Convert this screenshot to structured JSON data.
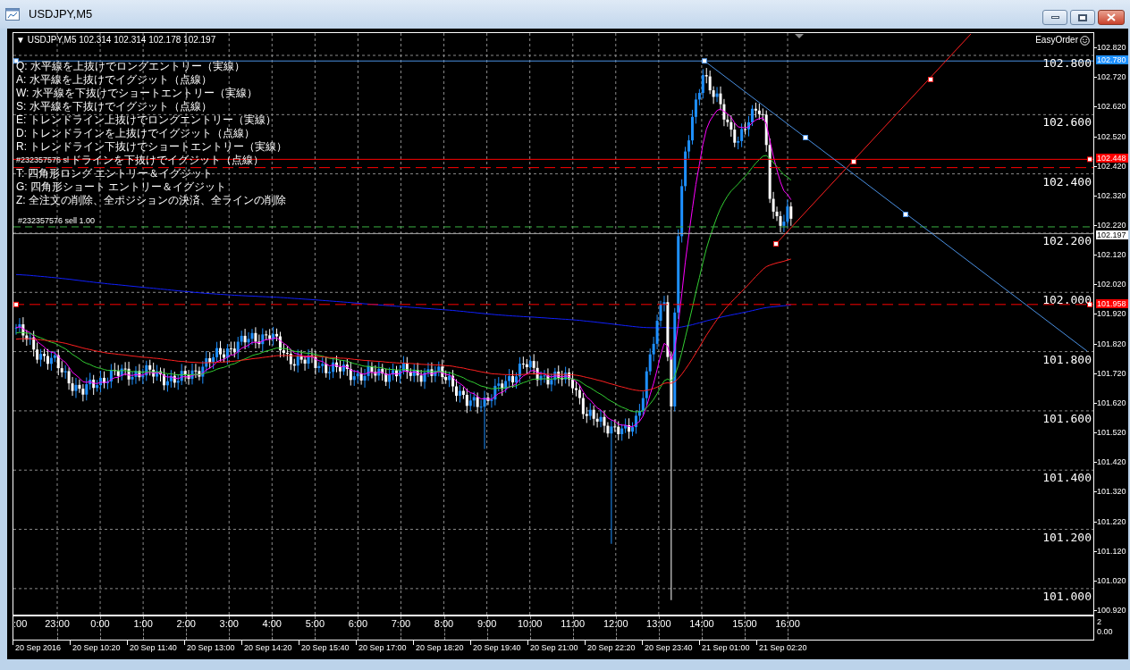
{
  "window": {
    "title": "USDJPY,M5"
  },
  "chart": {
    "header": "▼ USDJPY,M5  102.314 102.314 102.178 102.197",
    "panel_label": "EasyOrder",
    "instructions": [
      "Q: 水平線を上抜けでロングエントリー（実線）",
      "A: 水平線を上抜けでイグジット（点線）",
      "W: 水平線を下抜けでショートエントリー（実線）",
      "S: 水平線を下抜けでイグジット（点線）",
      "E: トレンドライン上抜けでロングエントリー（実線）",
      "D: トレンドラインを上抜けでイグジット（点線）",
      "R: トレンドライン下抜けでショートエントリー（実線）",
      "ドラインを下抜けでイグジット（点線）",
      "T: 四角形ロング エントリー＆イグジット",
      "G: 四角形ショート エントリー＆イグジット",
      "Z: 全注文の削除、全ポジションの決済、全ラインの削除"
    ],
    "stop_loss_label": "#232357576 sl",
    "order_label": "#232357576 sell 1.00",
    "level_labels": [
      "102.800",
      "102.600",
      "102.400",
      "102.200",
      "102.000",
      "101.800",
      "101.600",
      "101.400",
      "101.200",
      "101.000"
    ],
    "price_axis": [
      "102.820",
      "102.720",
      "102.620",
      "102.520",
      "102.420",
      "102.320",
      "102.220",
      "102.120",
      "102.020",
      "101.920",
      "101.820",
      "101.720",
      "101.620",
      "101.520",
      "101.420",
      "101.320",
      "101.220",
      "101.120",
      "101.020",
      "100.920"
    ],
    "price_markers": [
      {
        "text": "102.780",
        "color": "#1e90ff"
      },
      {
        "text": "102.448",
        "color": "#ff0000"
      },
      {
        "text": "102.197",
        "color": "#ffffff"
      },
      {
        "text": "101.958",
        "color": "#ff0000"
      }
    ]
  },
  "indicator": {
    "hour_labels": [
      ":00",
      "23:00",
      "0:00",
      "1:00",
      "2:00",
      "3:00",
      "4:00",
      "5:00",
      "6:00",
      "7:00",
      "8:00",
      "9:00",
      "10:00",
      "11:00",
      "12:00",
      "13:00",
      "14:00",
      "15:00",
      "16:00"
    ],
    "axis": [
      "2",
      "0.00"
    ]
  },
  "date_axis": [
    "20 Sep 2016",
    "20 Sep 10:20",
    "20 Sep 11:40",
    "20 Sep 13:00",
    "20 Sep 14:20",
    "20 Sep 15:40",
    "20 Sep 17:00",
    "20 Sep 18:20",
    "20 Sep 19:40",
    "20 Sep 21:00",
    "20 Sep 22:20",
    "20 Sep 23:40",
    "21 Sep 01:00",
    "21 Sep 02:20"
  ]
}
